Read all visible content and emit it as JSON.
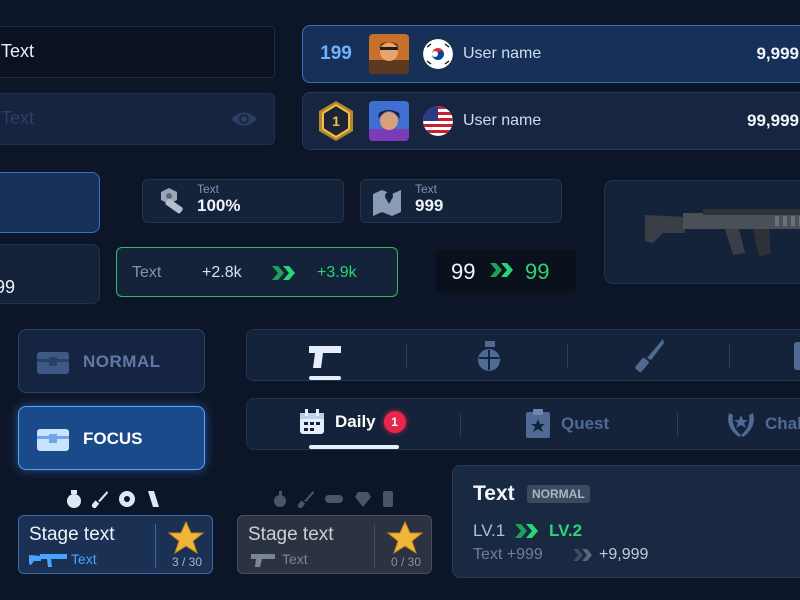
{
  "inputs": {
    "filled_value": "Text",
    "placeholder_value": "Text"
  },
  "leaderboard": [
    {
      "rank": "199",
      "name": "User name",
      "score": "9,999"
    },
    {
      "rank": "1",
      "name": "User name",
      "score": "99,999"
    }
  ],
  "stats": {
    "parts": {
      "label": "Text",
      "value": "100%"
    },
    "map": {
      "label": "Text",
      "value": "999"
    },
    "left_box_value": "99"
  },
  "upgrade_green": {
    "label": "Text",
    "from": "+2.8k",
    "to": "+3.9k"
  },
  "upgrade_plain": {
    "from": "99",
    "to": "99"
  },
  "side_tabs": {
    "normal": "NORMAL",
    "focus": "FOCUS"
  },
  "quest_tabs": {
    "daily": "Daily",
    "daily_badge": "1",
    "quest": "Quest",
    "challenge": "Chal"
  },
  "stage_cards": [
    {
      "title": "Stage text",
      "sub": "Text",
      "count": "3 / 30"
    },
    {
      "title": "Stage text",
      "sub": "Text",
      "count": "0 / 30"
    }
  ],
  "info_card": {
    "title": "Text",
    "badge": "NORMAL",
    "lv_from": "LV.1",
    "lv_to": "LV.2",
    "text_from": "Text +999",
    "text_to": "+9,999"
  },
  "colors": {
    "background": "#0d1628",
    "accent_blue": "#4aa3ff",
    "accent_green": "#22e07a",
    "gold": "#f0b63a",
    "badge_red": "#e8264b"
  }
}
